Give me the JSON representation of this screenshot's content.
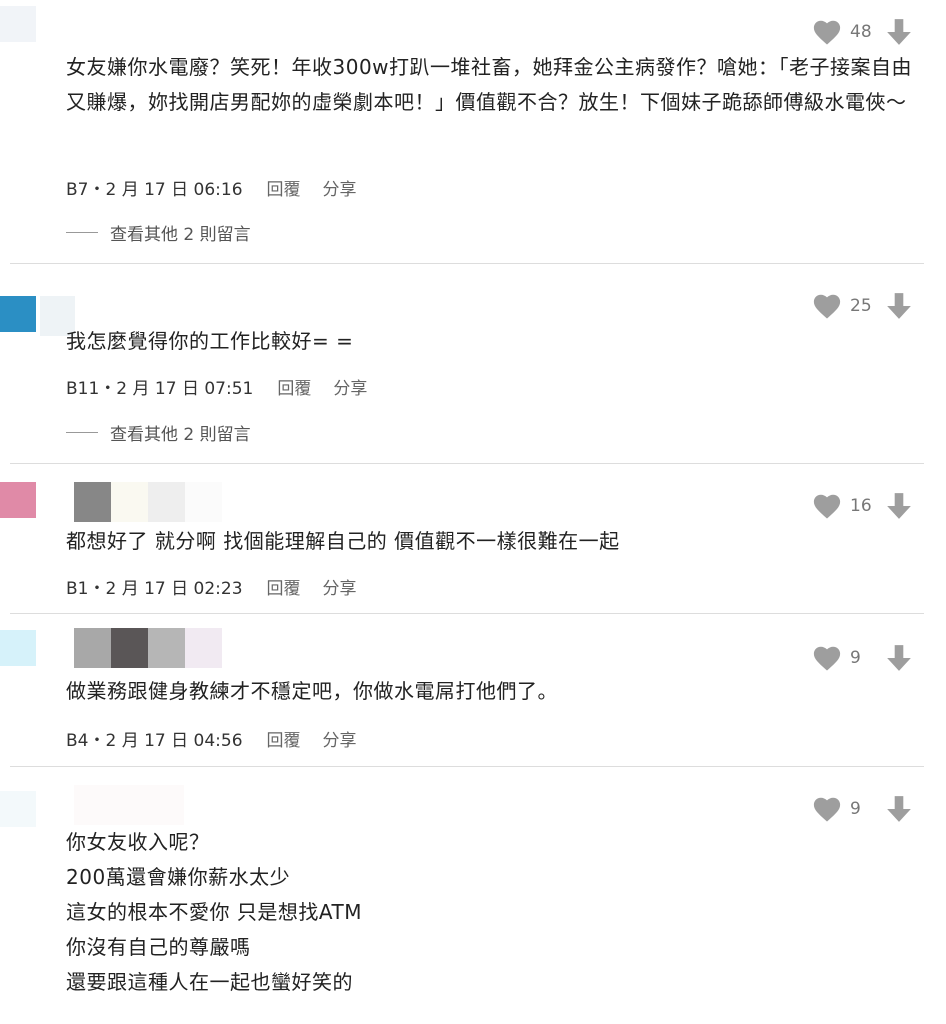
{
  "comments": [
    {
      "likes": "48",
      "text": "女友嫌你水電廢？笑死！年收300w打趴一堆社畜，她拜金公主病發作？嗆她：「老子接案自由又賺爆，妳找開店男配妳的虛榮劇本吧！」價值觀不合？放生！下個妹子跪舔師傅級水電俠～",
      "floor_date": "B7・2 月 17 日 06:16",
      "reply": "回覆",
      "share": "分享",
      "more_replies": "查看其他 2 則留言"
    },
    {
      "likes": "25",
      "text": "我怎麼覺得你的工作比較好= =",
      "floor_date": "B11・2 月 17 日 07:51",
      "reply": "回覆",
      "share": "分享",
      "more_replies": "查看其他 2 則留言"
    },
    {
      "likes": "16",
      "text": "都想好了 就分啊 找個能理解自己的 價值觀不一樣很難在一起",
      "floor_date": "B1・2 月 17 日 02:23",
      "reply": "回覆",
      "share": "分享"
    },
    {
      "likes": "9",
      "text": "做業務跟健身教練才不穩定吧，你做水電屌打他們了。",
      "floor_date": "B4・2 月 17 日 04:56",
      "reply": "回覆",
      "share": "分享"
    },
    {
      "likes": "9",
      "lines": [
        "你女友收入呢？",
        "200萬還會嫌你薪水太少",
        "這女的根本不愛你 只是想找ATM",
        "你沒有自己的尊嚴嗎",
        "還要跟這種人在一起也蠻好笑的"
      ]
    }
  ],
  "colors": {
    "avatar_blue": "#2b8fc4",
    "avatar_pink": "#e08aa7",
    "avatar_lightblue": "#d6f2fa",
    "icon_gray": "#9e9e9e"
  }
}
